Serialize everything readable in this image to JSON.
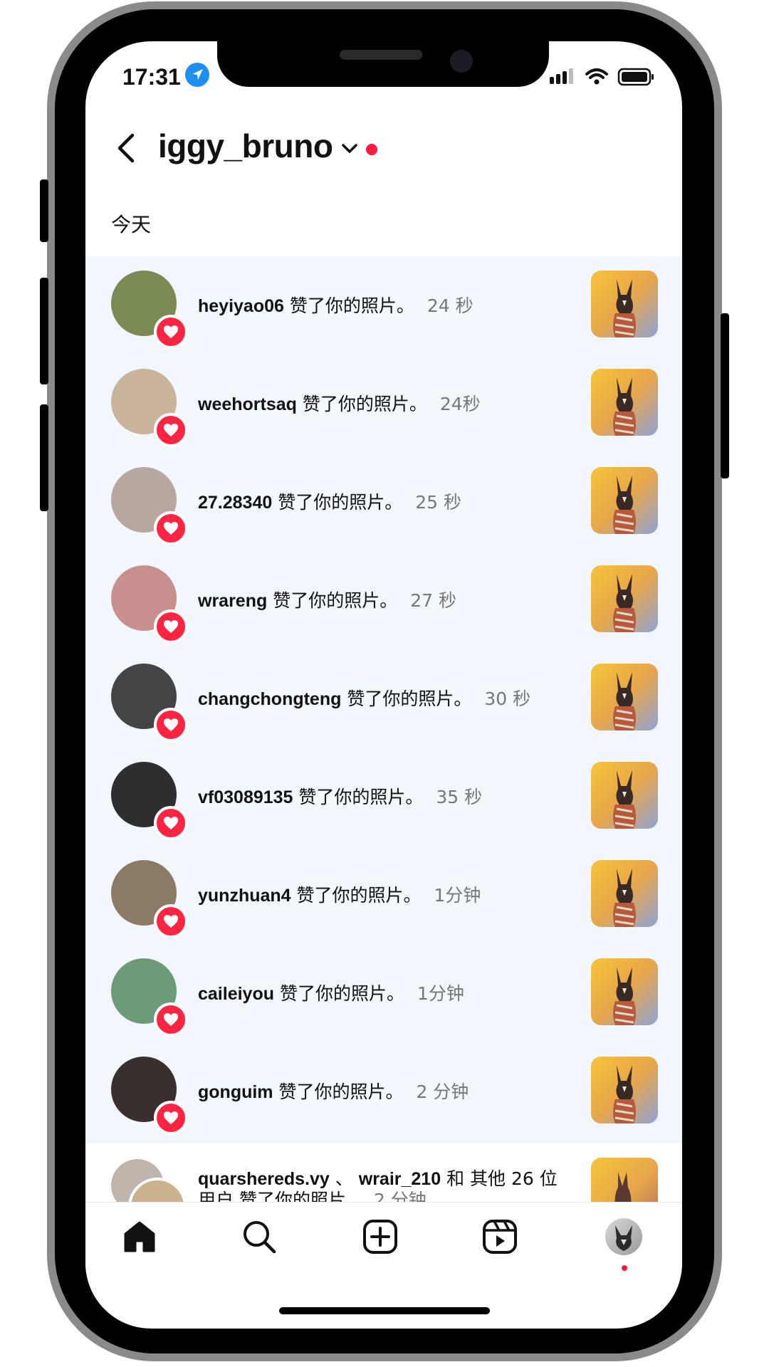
{
  "status_bar": {
    "time": "17:31"
  },
  "header": {
    "username": "iggy_bruno"
  },
  "section_label": "今天",
  "action_text": "赞了你的照片。",
  "notifications": [
    {
      "user": "heyiyao06",
      "ago": "24 秒",
      "avatar_color": "#7a8a55"
    },
    {
      "user": "weehortsaq",
      "ago": "24秒",
      "avatar_color": "#c9b39a"
    },
    {
      "user": "27.28340",
      "ago": "25 秒",
      "avatar_color": "#b8a7a0"
    },
    {
      "user": "wrareng",
      "ago": "27 秒",
      "avatar_color": "#c98f8f"
    },
    {
      "user": "changchongteng",
      "ago": "30 秒",
      "avatar_color": "#444444"
    },
    {
      "user": "vf03089135",
      "ago": "35 秒",
      "avatar_color": "#2e2e30"
    },
    {
      "user": "yunzhuan4",
      "ago": "1分钟",
      "avatar_color": "#8a7a66"
    },
    {
      "user": "caileiyou",
      "ago": "1分钟",
      "avatar_color": "#6d9b77"
    },
    {
      "user": "gonguim",
      "ago": "2 分钟",
      "avatar_color": "#3a2f2f"
    }
  ],
  "last_notification": {
    "line1_user1": "quarshereds.vy",
    "line1_sep": "、",
    "line1_user2": "wrair_210",
    "line1_rest": "和 其他 26 位",
    "line2_prefix": "用户",
    "line2_ago": "2 分钟"
  },
  "colors": {
    "accent_red": "#ff2442",
    "list_bg": "#f1f7fc",
    "location_blue": "#1f8ef1"
  },
  "tabs": [
    {
      "name": "home-icon"
    },
    {
      "name": "search-icon"
    },
    {
      "name": "create-post-icon"
    },
    {
      "name": "reels-icon"
    },
    {
      "name": "profile-avatar"
    }
  ]
}
